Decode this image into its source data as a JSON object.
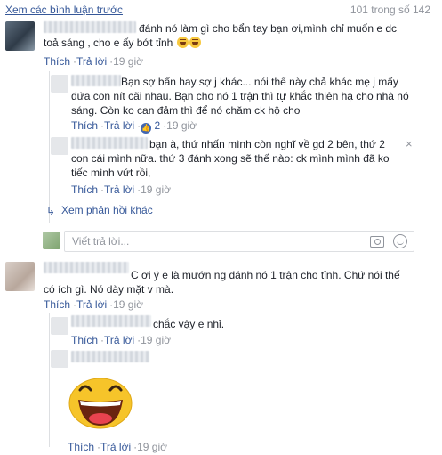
{
  "header": {
    "prev_comments_link": "Xem các bình luận trước",
    "count": "101 trong số 142"
  },
  "actions": {
    "like": "Thích",
    "reply": "Trả lời",
    "dot": "·",
    "time": "19 giờ"
  },
  "comments": {
    "c1": {
      "text": "đánh nó làm gì cho bẩn tay bạn ơi,mình chỉ muốn e dc toả sáng , cho e ấy bớt tỉnh"
    },
    "r1": {
      "text": "Bạn sợ bẩn hay sợ j khác... nói thế này chả khác mẹ j mấy đứa con nít cãi nhau. Bạn cho nó 1 trận thì tự khắc thiên hạ cho nhà nó sáng. Còn ko can đảm thì để nó chăm ck hộ cho",
      "reactions": "2"
    },
    "r2": {
      "text": "bạn à, thứ nhấn mình còn nghĩ về gd 2 bên, thứ 2 con cái mình nữa. thứ 3 đánh xong sẽ thế nào: ck mình mình đã ko tiếc mình vứt rồi,"
    },
    "more_replies": "Xem phản hồi khác",
    "reply_placeholder": "Viết trả lời...",
    "c2": {
      "text": "C ơi ý e là mướn ng đánh nó 1 trận cho tỉnh. Chứ nói thế có ích gì. Nó dày mặt v mà."
    },
    "r3": {
      "text": "chắc vậy e nhỉ."
    }
  },
  "icons": {
    "close": "×",
    "more_arrow": "↳",
    "camera": "camera-icon",
    "emoji": "emoji-icon"
  },
  "colors": {
    "link": "#365899",
    "muted": "#90949c",
    "like_blue": "#4267b2",
    "emoji_yellow": "#f7c83e"
  }
}
